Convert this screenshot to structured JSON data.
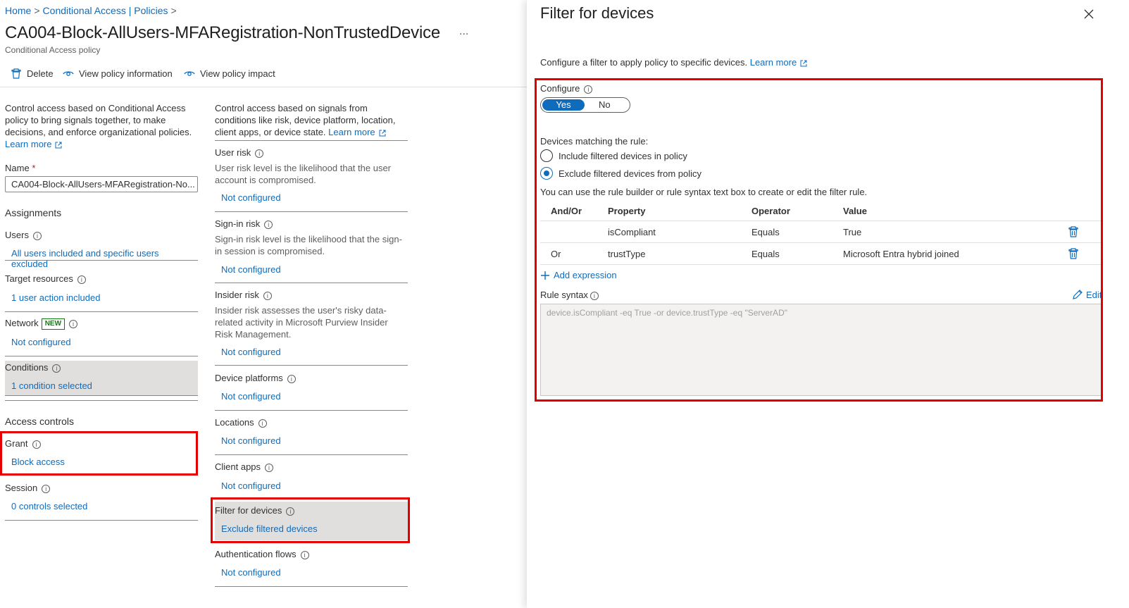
{
  "breadcrumb": {
    "home": "Home",
    "section": "Conditional Access | Policies",
    "sep": ">"
  },
  "page": {
    "title": "CA004-Block-AllUsers-MFARegistration-NonTrustedDevice",
    "more": "...",
    "subtitle": "Conditional Access policy"
  },
  "toolbar": {
    "delete": "Delete",
    "view_info": "View policy information",
    "view_impact": "View policy impact"
  },
  "left": {
    "description": "Control access based on Conditional Access policy to bring signals together, to make decisions, and enforce organizational policies.",
    "learn_more": "Learn more",
    "name_label": "Name",
    "required_mark": "*",
    "name_value": "CA004-Block-AllUsers-MFARegistration-No...",
    "assignments_heading": "Assignments",
    "users_label": "Users",
    "users_value": "All users included and specific users excluded",
    "target_label": "Target resources",
    "target_value": "1 user action included",
    "network_label": "Network",
    "network_badge": "NEW",
    "network_value": "Not configured",
    "conditions_label": "Conditions",
    "conditions_value": "1 condition selected",
    "access_heading": "Access controls",
    "grant_label": "Grant",
    "grant_value": "Block access",
    "session_label": "Session",
    "session_value": "0 controls selected"
  },
  "mid": {
    "description": "Control access based on signals from conditions like risk, device platform, location, client apps, or device state.",
    "learn_more": "Learn more",
    "user_risk_label": "User risk",
    "user_risk_desc": "User risk level is the likelihood that the user account is compromised.",
    "user_risk_value": "Not configured",
    "signin_risk_label": "Sign-in risk",
    "signin_risk_desc": "Sign-in risk level is the likelihood that the sign-in session is compromised.",
    "signin_risk_value": "Not configured",
    "insider_label": "Insider risk",
    "insider_desc": "Insider risk assesses the user's risky data-related activity in Microsoft Purview Insider Risk Management.",
    "insider_value": "Not configured",
    "platforms_label": "Device platforms",
    "platforms_value": "Not configured",
    "locations_label": "Locations",
    "locations_value": "Not configured",
    "client_label": "Client apps",
    "client_value": "Not configured",
    "filter_label": "Filter for devices",
    "filter_value": "Exclude filtered devices",
    "auth_label": "Authentication flows",
    "auth_value": "Not configured"
  },
  "panel": {
    "title": "Filter for devices",
    "description": "Configure a filter to apply policy to specific devices.",
    "learn_more": "Learn more",
    "configure_label": "Configure",
    "toggle_yes": "Yes",
    "toggle_no": "No",
    "matching_label": "Devices matching the rule:",
    "include_option": "Include filtered devices in policy",
    "exclude_option": "Exclude filtered devices from policy",
    "rule_help": "You can use the rule builder or rule syntax text box to create or edit the filter rule.",
    "columns": {
      "andor": "And/Or",
      "property": "Property",
      "operator": "Operator",
      "value": "Value"
    },
    "rows": [
      {
        "andor": "",
        "property": "isCompliant",
        "operator": "Equals",
        "value": "True"
      },
      {
        "andor": "Or",
        "property": "trustType",
        "operator": "Equals",
        "value": "Microsoft Entra hybrid joined"
      }
    ],
    "add_expression": "Add expression",
    "syntax_label": "Rule syntax",
    "edit": "Edit",
    "syntax_value": "device.isCompliant -eq True -or device.trustType -eq \"ServerAD\""
  },
  "colors": {
    "link": "#0f6cbd",
    "highlight": "#e50000",
    "selected_bg": "#e1dfdd"
  }
}
